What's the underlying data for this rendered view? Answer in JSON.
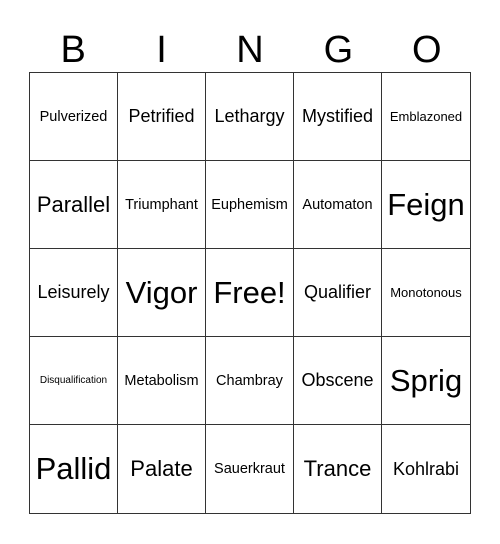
{
  "header": [
    "B",
    "I",
    "N",
    "G",
    "O"
  ],
  "cells": [
    {
      "text": "Pulverized",
      "size": "s"
    },
    {
      "text": "Petrified",
      "size": "m"
    },
    {
      "text": "Lethargy",
      "size": "m"
    },
    {
      "text": "Mystified",
      "size": "m"
    },
    {
      "text": "Emblazoned",
      "size": "xs"
    },
    {
      "text": "Parallel",
      "size": "l"
    },
    {
      "text": "Triumphant",
      "size": "s"
    },
    {
      "text": "Euphemism",
      "size": "s"
    },
    {
      "text": "Automaton",
      "size": "s"
    },
    {
      "text": "Feign",
      "size": "xl"
    },
    {
      "text": "Leisurely",
      "size": "m"
    },
    {
      "text": "Vigor",
      "size": "xl"
    },
    {
      "text": "Free!",
      "size": "xl"
    },
    {
      "text": "Qualifier",
      "size": "m"
    },
    {
      "text": "Monotonous",
      "size": "xs"
    },
    {
      "text": "Disqualification",
      "size": "xxs"
    },
    {
      "text": "Metabolism",
      "size": "s"
    },
    {
      "text": "Chambray",
      "size": "s"
    },
    {
      "text": "Obscene",
      "size": "m"
    },
    {
      "text": "Sprig",
      "size": "xl"
    },
    {
      "text": "Pallid",
      "size": "xl"
    },
    {
      "text": "Palate",
      "size": "l"
    },
    {
      "text": "Sauerkraut",
      "size": "s"
    },
    {
      "text": "Trance",
      "size": "l"
    },
    {
      "text": "Kohlrabi",
      "size": "m"
    }
  ]
}
